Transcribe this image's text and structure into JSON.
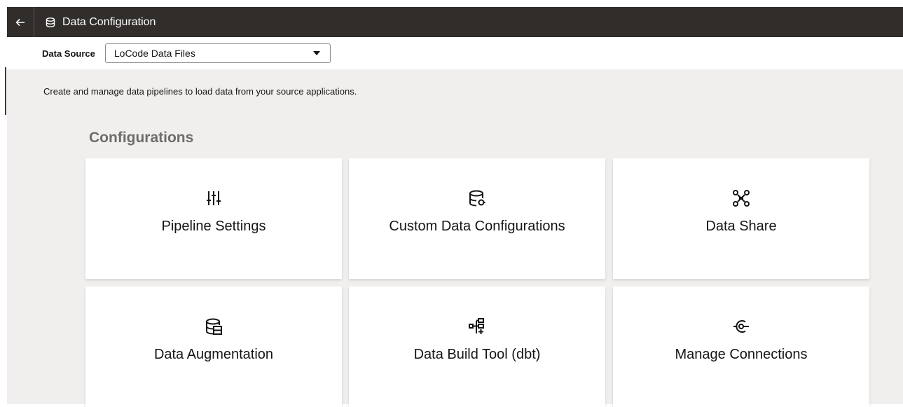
{
  "header": {
    "back_icon": "arrow-left-icon",
    "title_icon": "database-icon",
    "title": "Data Configuration"
  },
  "data_source": {
    "label": "Data Source",
    "selected": "LoCode Data Files"
  },
  "main": {
    "description": "Create and manage data pipelines to load data from your source applications.",
    "section_title": "Configurations",
    "cards": [
      {
        "label": "Pipeline Settings",
        "icon": "sliders-icon"
      },
      {
        "label": "Custom Data Configurations",
        "icon": "database-config-icon"
      },
      {
        "label": "Data Share",
        "icon": "share-network-icon"
      },
      {
        "label": "Data Augmentation",
        "icon": "database-table-icon"
      },
      {
        "label": "Data Build Tool (dbt)",
        "icon": "flow-tree-icon"
      },
      {
        "label": "Manage Connections",
        "icon": "connection-icon"
      }
    ]
  },
  "colors": {
    "header_bg": "#312d2a",
    "content_bg": "#f1efed",
    "card_bg": "#ffffff",
    "section_title": "#6f6c69"
  }
}
